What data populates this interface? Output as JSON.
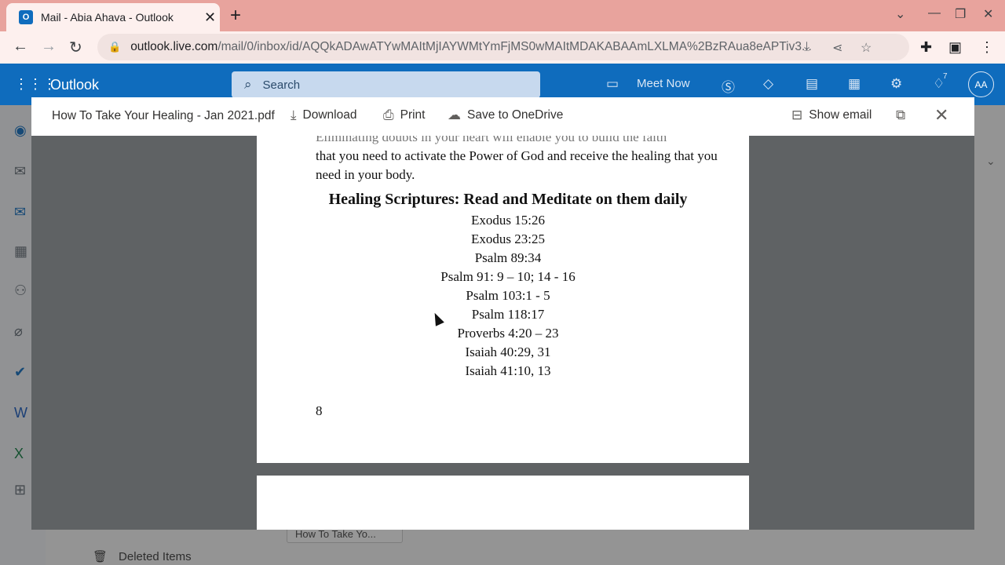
{
  "browser": {
    "tab_title": "Mail - Abia Ahava - Outlook",
    "tab_favicon": "O",
    "url_host": "outlook.live.com",
    "url_path": "/mail/0/inbox/id/AQQkADAwATYwMAItMjIAYWMtYmFjMS0wMAItMDAKABAAmLXLMA%2BzRAua8eAPTiv3...",
    "icons": [
      "back-icon",
      "forward-icon",
      "reload-icon",
      "lock-icon",
      "install-icon",
      "share-icon",
      "star-icon",
      "extensions-icon",
      "sidepanel-icon",
      "menu-icon"
    ]
  },
  "outlook": {
    "brand": "Outlook",
    "search_placeholder": "Search",
    "meet_now": "Meet Now",
    "notification_count": "7",
    "avatar_initials": "AA",
    "accent_color": "#0f6cbd"
  },
  "background": {
    "deleted_items": "Deleted Items",
    "attachment_chip": "How To Take Yo..."
  },
  "viewer": {
    "file_name": "How To Take Your Healing - Jan 2021.pdf",
    "download": "Download",
    "print": "Print",
    "save_onedrive": "Save to OneDrive",
    "show_email": "Show email"
  },
  "document": {
    "partial_line": "Eliminating doubts in your heart will enable you to build the faith",
    "paragraph": "that you need to activate the Power of God and receive the healing that you need in your body.",
    "heading": "Healing Scriptures: Read and Meditate on them daily",
    "scriptures": [
      "Exodus 15:26",
      "Exodus 23:25",
      "Psalm 89:34",
      "Psalm 91: 9 – 10; 14 - 16",
      "Psalm 103:1 - 5",
      "Psalm 118:17",
      "Proverbs 4:20 – 23",
      "Isaiah 40:29, 31",
      "Isaiah 41:10, 13"
    ],
    "page_number": "8"
  }
}
